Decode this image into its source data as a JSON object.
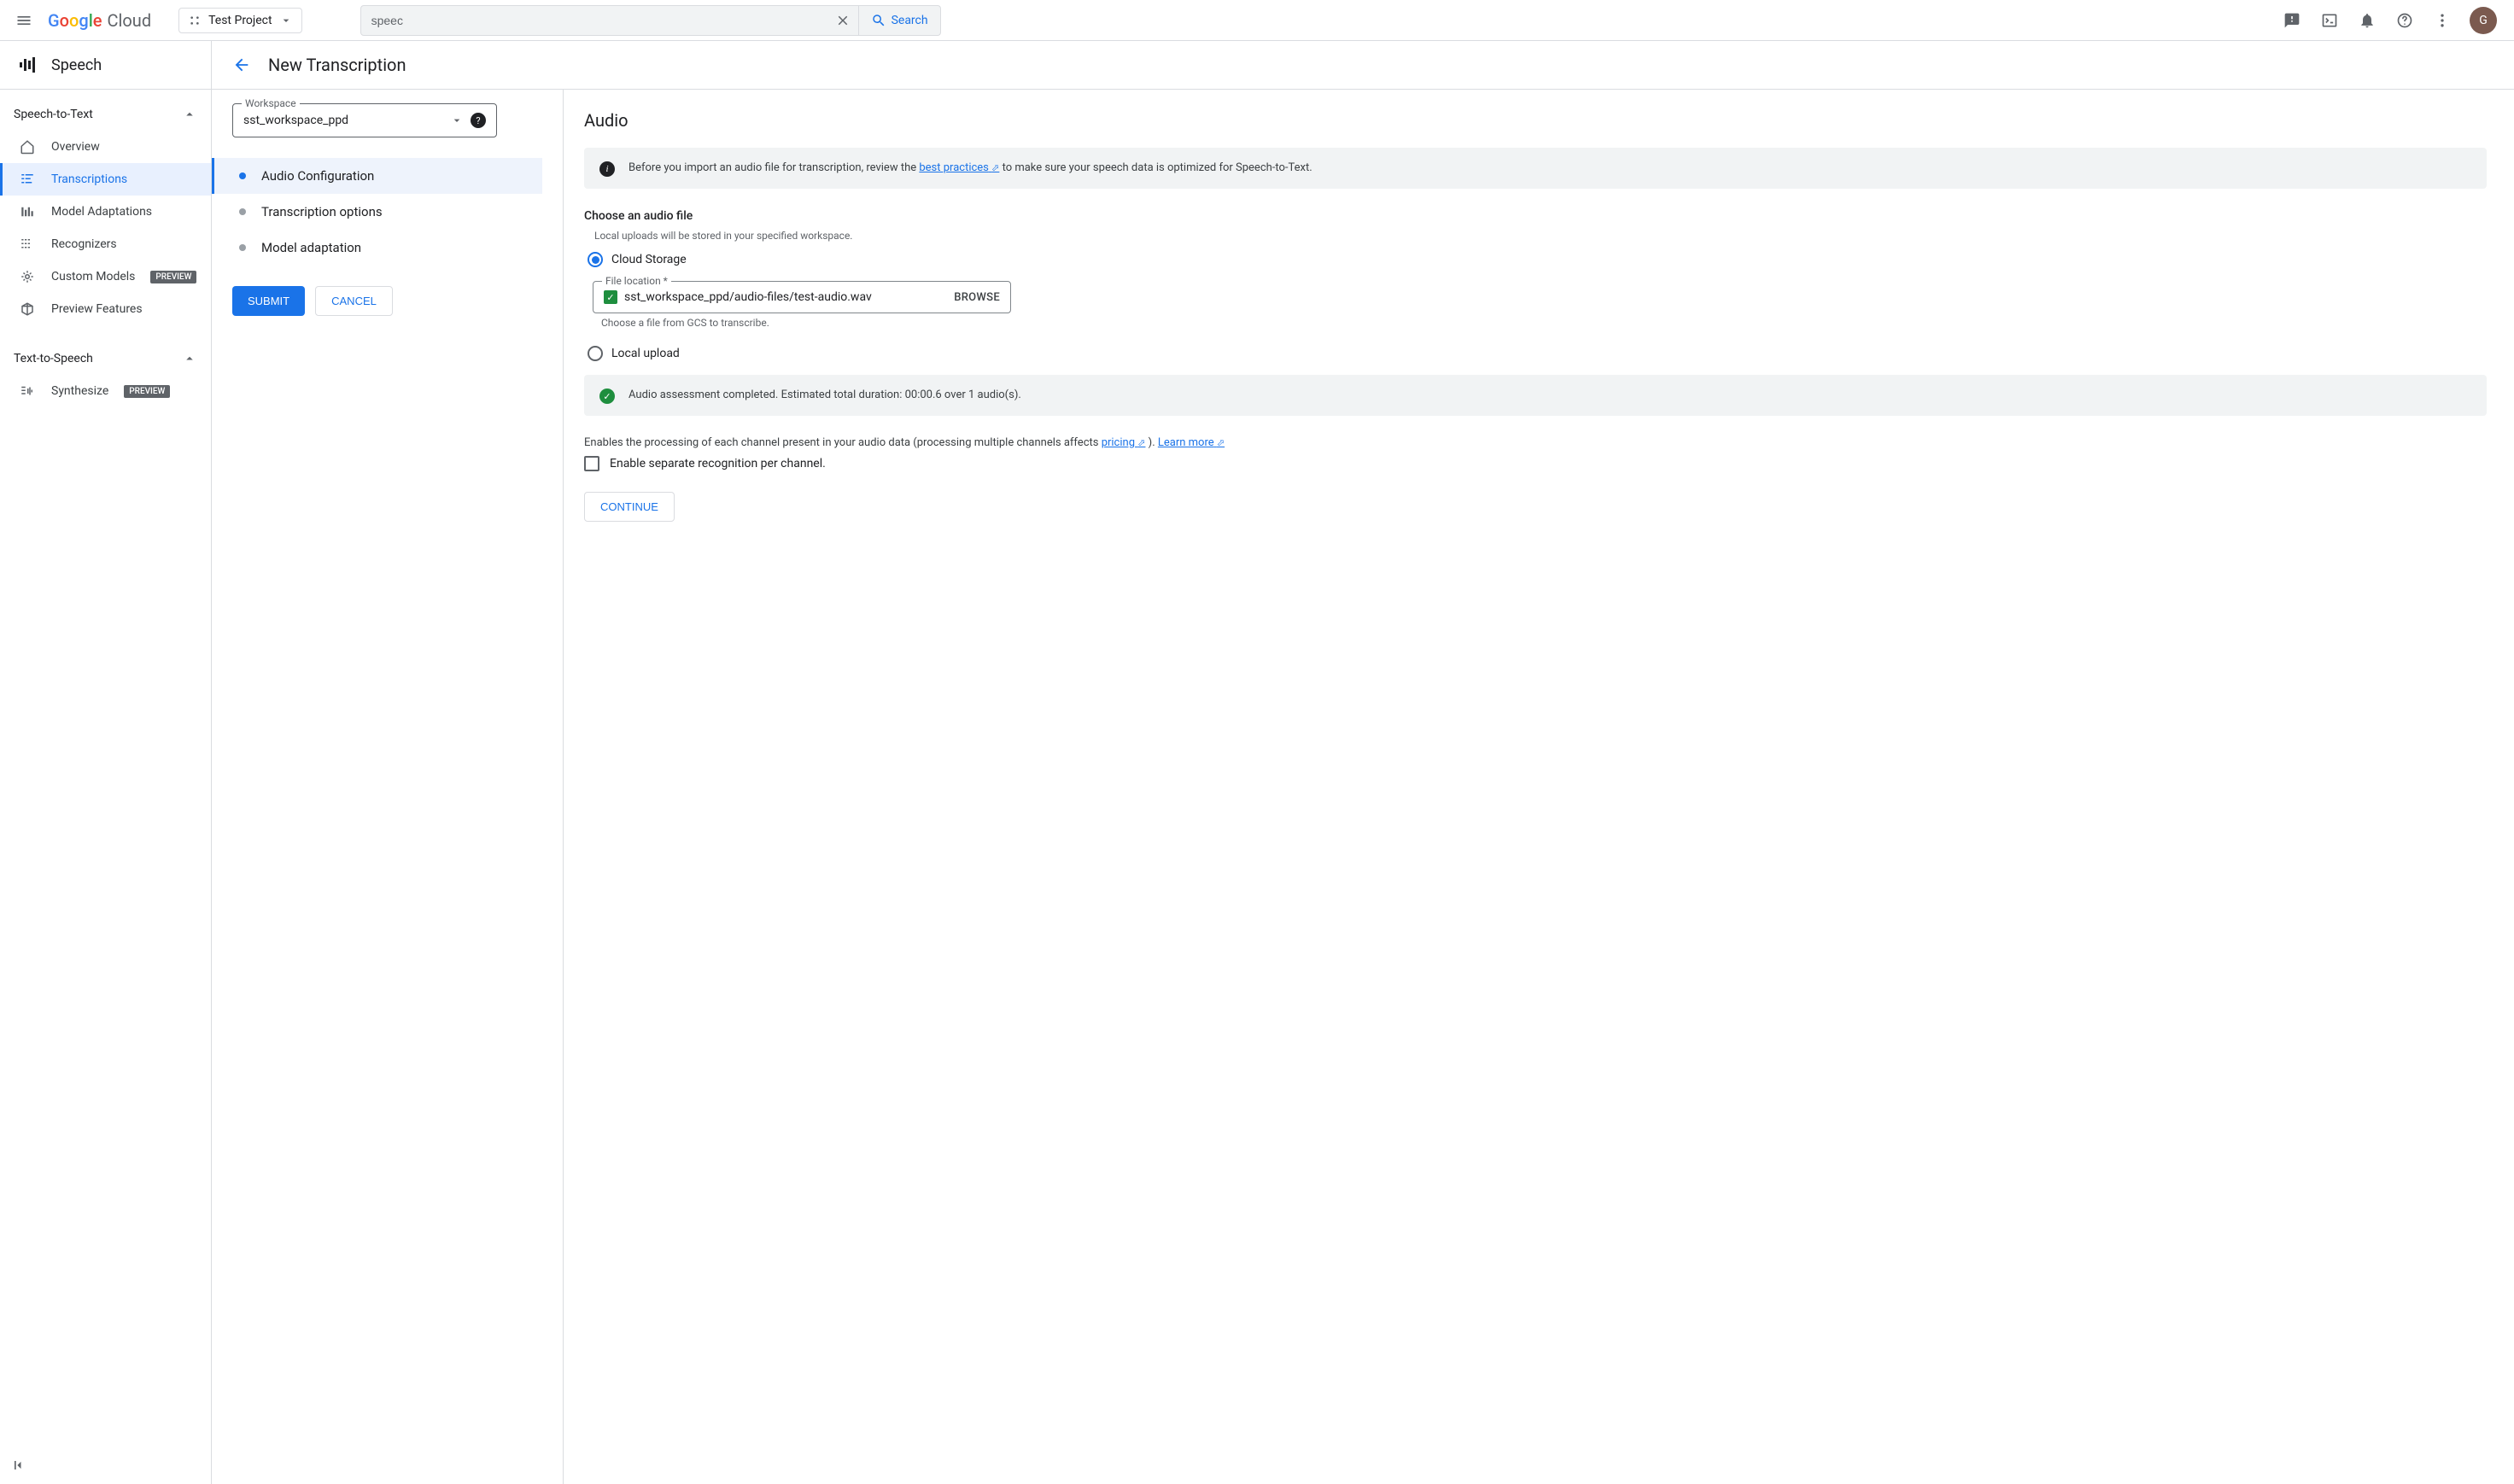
{
  "header": {
    "logo_cloud": "Cloud",
    "project": "Test Project",
    "search_value": "speec",
    "search_label": "Search",
    "avatar_initial": "G"
  },
  "sidebar": {
    "title": "Speech",
    "sections": [
      {
        "title": "Speech-to-Text",
        "items": [
          {
            "label": "Overview",
            "active": false
          },
          {
            "label": "Transcriptions",
            "active": true
          },
          {
            "label": "Model Adaptations",
            "active": false
          },
          {
            "label": "Recognizers",
            "active": false
          },
          {
            "label": "Custom Models",
            "badge": "PREVIEW",
            "active": false
          },
          {
            "label": "Preview Features",
            "active": false
          }
        ]
      },
      {
        "title": "Text-to-Speech",
        "items": [
          {
            "label": "Synthesize",
            "badge": "PREVIEW",
            "active": false
          }
        ]
      }
    ]
  },
  "page": {
    "title": "New Transcription",
    "workspace_label": "Workspace",
    "workspace_value": "sst_workspace_ppd",
    "steps": [
      {
        "label": "Audio Configuration",
        "active": true
      },
      {
        "label": "Transcription options",
        "active": false
      },
      {
        "label": "Model adaptation",
        "active": false
      }
    ],
    "submit": "SUBMIT",
    "cancel": "CANCEL"
  },
  "content": {
    "audio_title": "Audio",
    "info_prefix": "Before you import an audio file for transcription, review the ",
    "info_link": "best practices",
    "info_suffix": " to make sure your speech data is optimized for Speech-to-Text.",
    "choose_title": "Choose an audio file",
    "choose_hint": "Local uploads will be stored in your specified workspace.",
    "radio_cloud": "Cloud Storage",
    "radio_local": "Local upload",
    "file_label": "File location *",
    "file_value": "sst_workspace_ppd/audio-files/test-audio.wav",
    "browse": "BROWSE",
    "file_hint": "Choose a file from GCS to transcribe.",
    "assessment": "Audio assessment completed. Estimated total duration: 00:00.6 over 1 audio(s).",
    "channel_text_prefix": "Enables the processing of each channel present in your audio data (processing multiple channels affects ",
    "channel_link1": "pricing",
    "channel_text_mid": " ). ",
    "channel_link2": "Learn more",
    "channel_checkbox": "Enable separate recognition per channel.",
    "continue": "CONTINUE"
  }
}
